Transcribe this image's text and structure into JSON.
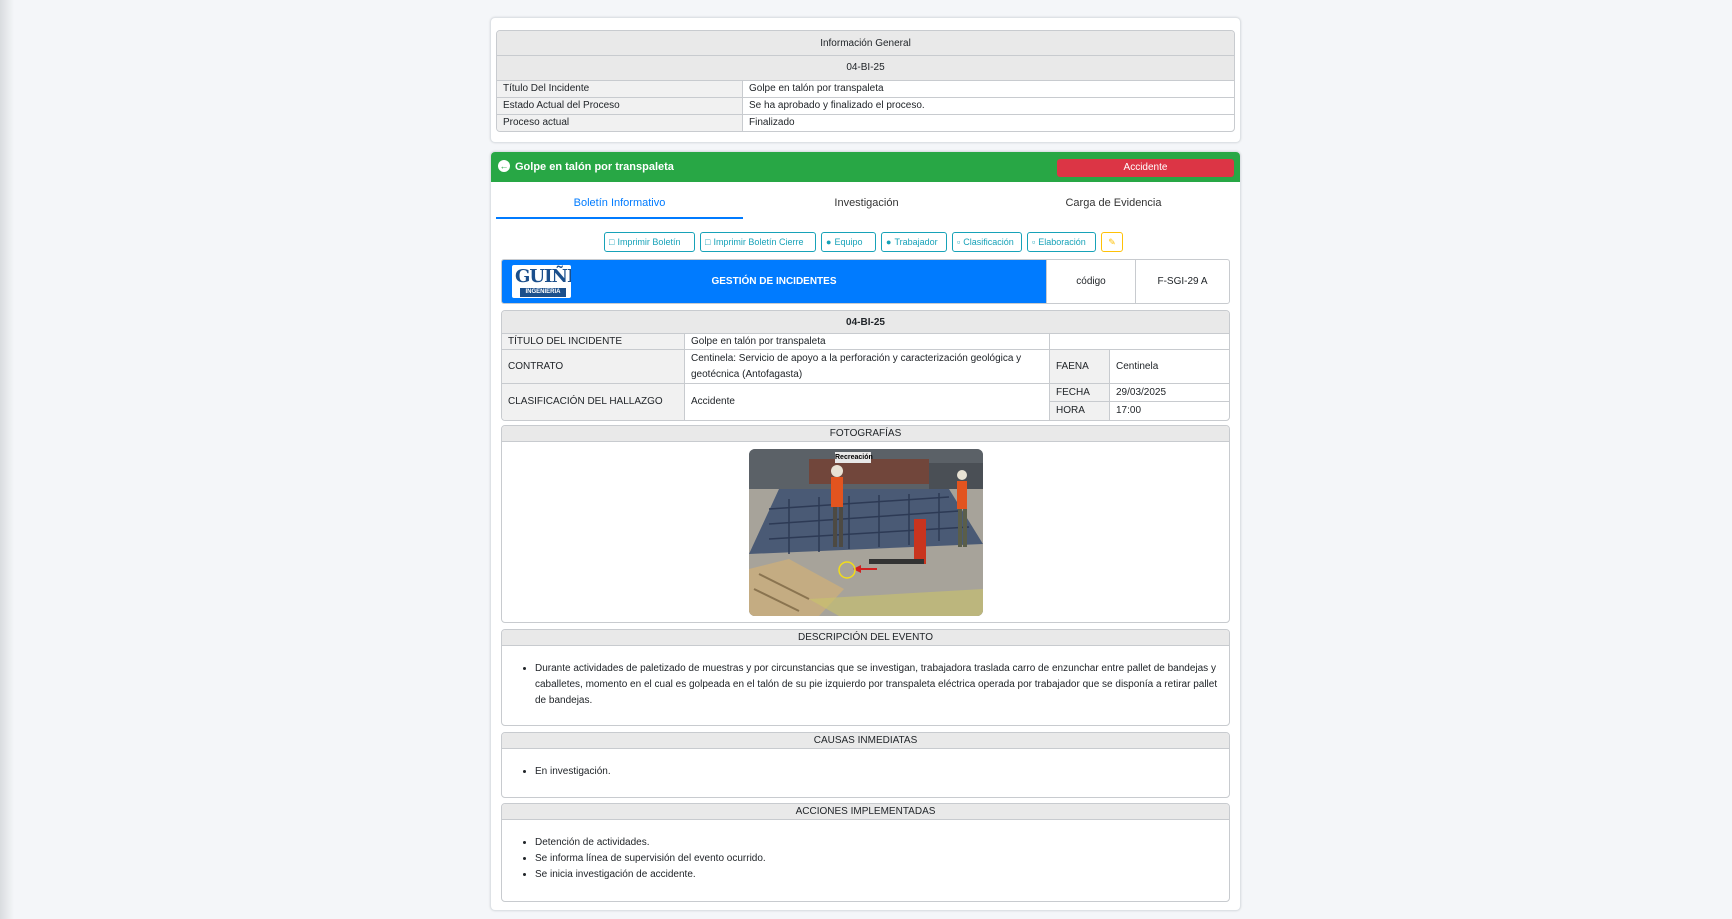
{
  "info": {
    "heading": "Información General",
    "code": "04-BI-25",
    "rows": [
      {
        "label": "Título Del Incidente",
        "value": "Golpe en talón por transpaleta"
      },
      {
        "label": "Estado Actual del Proceso",
        "value": "Se ha aprobado y finalizado el proceso."
      },
      {
        "label": "Proceso actual",
        "value": "Finalizado"
      }
    ]
  },
  "header": {
    "title": "Golpe en talón por transpaleta",
    "badge": "Accidente",
    "colors": {
      "success": "#28a745",
      "danger": "#dc3545",
      "primary": "#007bff",
      "info": "#17a2b8",
      "warning": "#ffc107"
    }
  },
  "tabs": [
    {
      "label": "Boletín Informativo",
      "active": true
    },
    {
      "label": "Investigación",
      "active": false
    },
    {
      "label": "Carga de Evidencia",
      "active": false
    }
  ],
  "toolbar": [
    {
      "label": "Imprimir Boletín",
      "icon": "file-pdf-icon"
    },
    {
      "label": "Imprimir Boletín Cierre",
      "icon": "file-pdf-icon"
    },
    {
      "label": "Equipo",
      "icon": "users-icon"
    },
    {
      "label": "Trabajador",
      "icon": "user-icon"
    },
    {
      "label": "Clasificación",
      "icon": "clipboard-icon"
    },
    {
      "label": "Elaboración",
      "icon": "file-icon"
    },
    {
      "label": "",
      "icon": "pencil-icon"
    }
  ],
  "doc": {
    "logo_big": "GUIÑEZ",
    "logo_small": "INGENIERIA",
    "title": "GESTIÓN DE INCIDENTES",
    "code_label": "código",
    "code_value": "F-SGI-29 A"
  },
  "detail": {
    "code": "04-BI-25",
    "titulo_label": "TÍTULO DEL INCIDENTE",
    "titulo_value": "Golpe en talón por transpaleta",
    "contrato_label": "CONTRATO",
    "contrato_value": "Centinela: Servicio de apoyo a la perforación y caracterización geológica y geotécnica (Antofagasta)",
    "faena_label": "FAENA",
    "faena_value": "Centinela",
    "clasif_label": "CLASIFICACIÓN DEL HALLAZGO",
    "clasif_value": "Accidente",
    "fecha_label": "FECHA",
    "fecha_value": "29/03/2025",
    "hora_label": "HORA",
    "hora_value": "17:00"
  },
  "fotos": {
    "heading": "FOTOGRAFÍAS",
    "caption": "Recreación"
  },
  "descripcion": {
    "heading": "DESCRIPCIÓN DEL EVENTO",
    "items": [
      "Durante actividades de paletizado de muestras y por circunstancias que se investigan, trabajadora traslada carro de enzunchar entre pallet de bandejas y caballetes, momento en el cual es golpeada en el talón de su pie izquierdo por transpaleta eléctrica operada por trabajador que se disponía a retirar pallet de bandejas."
    ]
  },
  "causas": {
    "heading": "CAUSAS INMEDIATAS",
    "items": [
      "En investigación."
    ]
  },
  "acciones": {
    "heading": "ACCIONES IMPLEMENTADAS",
    "items": [
      "Detención de actividades.",
      "Se informa línea de supervisión del evento ocurrido.",
      "Se inicia investigación de accidente."
    ]
  }
}
